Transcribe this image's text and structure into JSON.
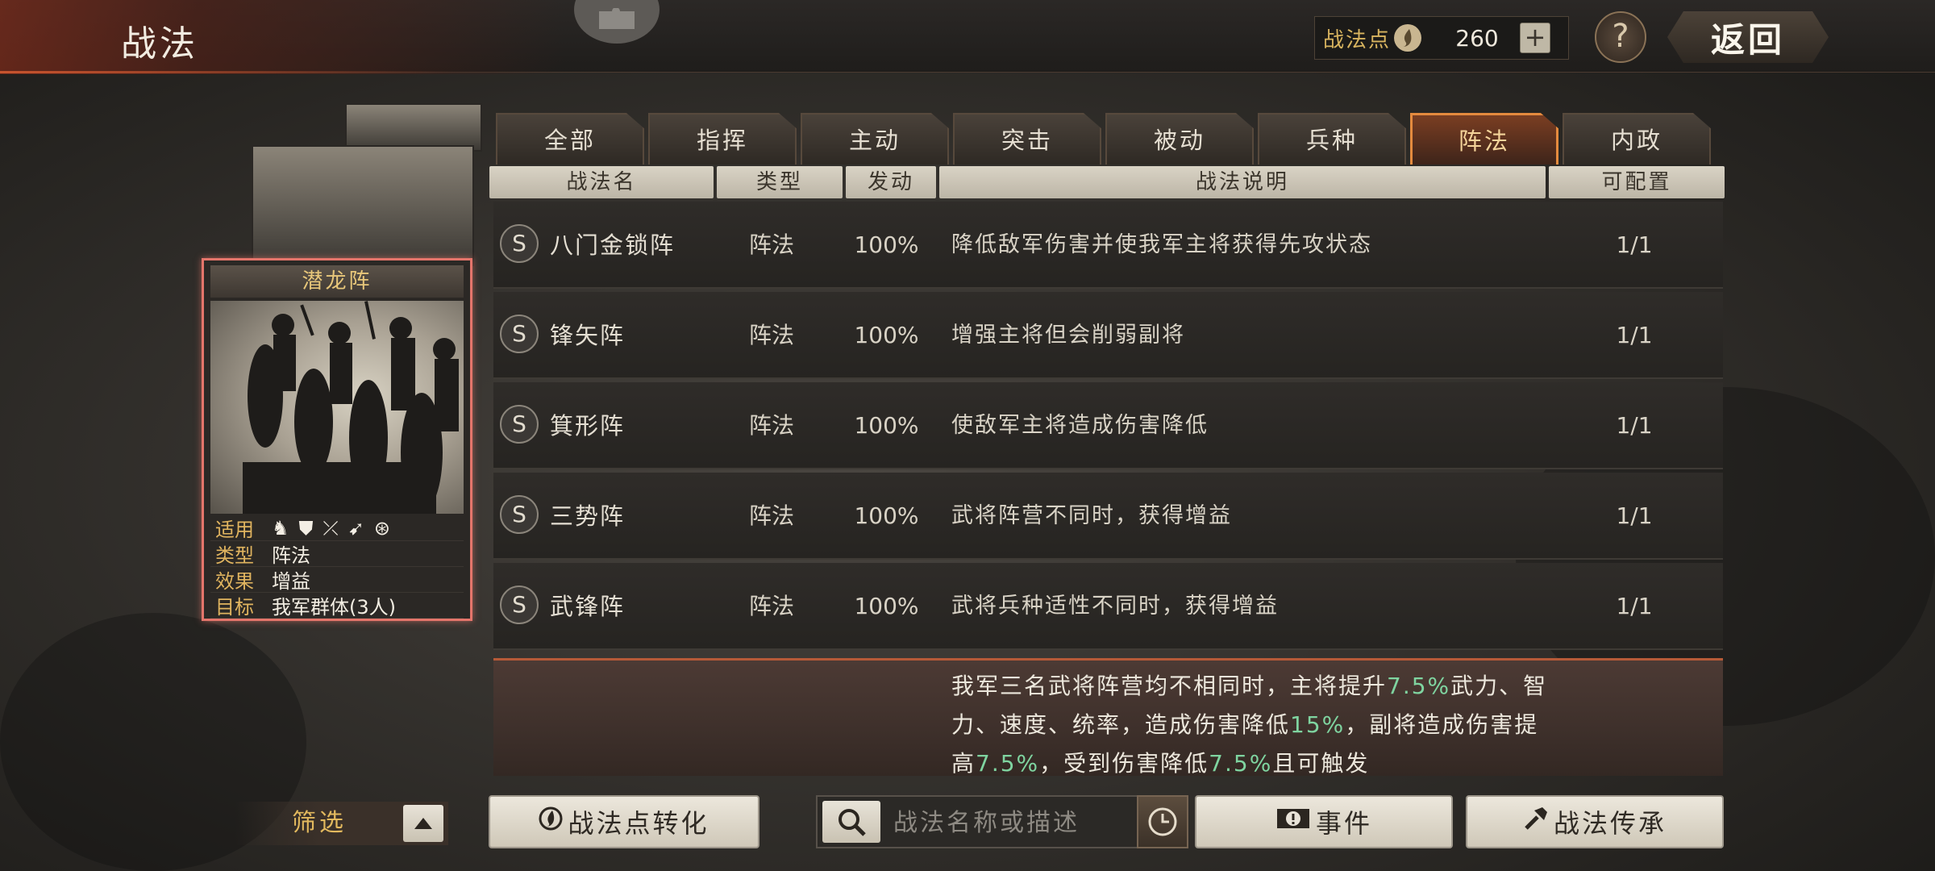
{
  "header": {
    "title": "战法",
    "points_label": "战法点",
    "points_value": "260",
    "back_label": "返回"
  },
  "card": {
    "name": "潜龙阵",
    "rows": [
      {
        "key": "适用"
      },
      {
        "key": "类型",
        "value": "阵法"
      },
      {
        "key": "效果",
        "value": "增益"
      },
      {
        "key": "目标",
        "value": "我军群体(3人)"
      }
    ],
    "applicable_icons": [
      "cavalry-icon",
      "shield-icon",
      "bow-icon",
      "spear-icon",
      "wheel-icon"
    ]
  },
  "tabs": [
    {
      "label": "全部"
    },
    {
      "label": "指挥"
    },
    {
      "label": "主动"
    },
    {
      "label": "突击"
    },
    {
      "label": "被动"
    },
    {
      "label": "兵种"
    },
    {
      "label": "阵法",
      "active": true
    },
    {
      "label": "内政"
    }
  ],
  "columns": {
    "name": "战法名",
    "type": "类型",
    "rate": "发动",
    "desc": "战法说明",
    "count": "可配置"
  },
  "rows": [
    {
      "grade": "S",
      "name": "八门金锁阵",
      "type": "阵法",
      "rate": "100%",
      "desc": "降低敌军伤害并使我军主将获得先攻状态",
      "count": "1/1"
    },
    {
      "grade": "S",
      "name": "锋矢阵",
      "type": "阵法",
      "rate": "100%",
      "desc": "增强主将但会削弱副将",
      "count": "1/1"
    },
    {
      "grade": "S",
      "name": "箕形阵",
      "type": "阵法",
      "rate": "100%",
      "desc": "使敌军主将造成伤害降低",
      "count": "1/1"
    },
    {
      "grade": "S",
      "name": "三势阵",
      "type": "阵法",
      "rate": "100%",
      "desc": "武将阵营不同时，获得增益",
      "count": "1/1"
    },
    {
      "grade": "S",
      "name": "武锋阵",
      "type": "阵法",
      "rate": "100%",
      "desc": "武将兵种适性不同时，获得增益",
      "count": "1/1"
    }
  ],
  "detail": {
    "t1": "我军三名武将阵营均不相同时，主将提升",
    "v1": "7.5%",
    "t2": "武力、智力、速度、统率，造成伤害降低",
    "v2": "15%",
    "t3": "，副将造成伤害提高",
    "v3": "7.5%",
    "t4": "，受到伤害降低",
    "v4": "7.5%",
    "t5": "且可触发"
  },
  "bottom": {
    "filter_label": "筛选",
    "convert_label": "战法点转化",
    "search_placeholder": "战法名称或描述",
    "events_label": "事件",
    "inherit_label": "战法传承"
  },
  "colors": {
    "accent_orange": "#e48a3e",
    "card_border": "#e4756b",
    "highlight_green": "#7fd4a0",
    "gold_label": "#e0b45f"
  }
}
